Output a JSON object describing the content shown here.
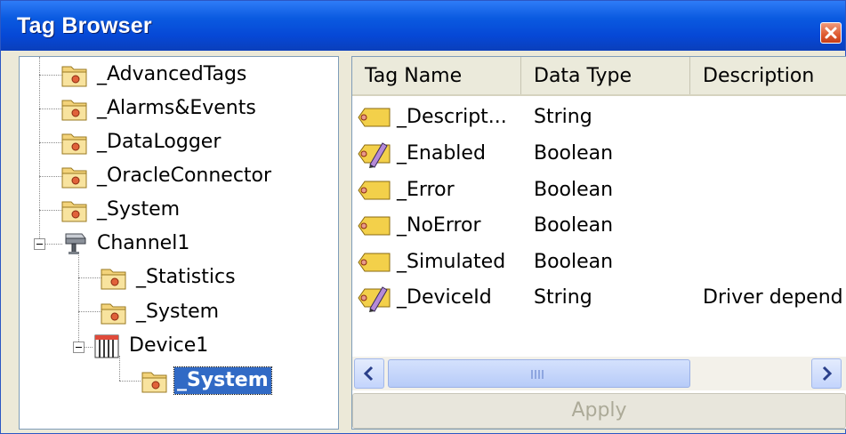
{
  "window": {
    "title": "Tag Browser"
  },
  "tree": {
    "items": [
      {
        "label": "_AdvancedTags",
        "icon": "folder-icon"
      },
      {
        "label": "_Alarms&Events",
        "icon": "folder-icon"
      },
      {
        "label": "_DataLogger",
        "icon": "folder-icon"
      },
      {
        "label": "_OracleConnector",
        "icon": "folder-icon"
      },
      {
        "label": "_System",
        "icon": "folder-icon"
      },
      {
        "label": "Channel1",
        "icon": "channel-icon"
      },
      {
        "label": "_Statistics",
        "icon": "folder-icon"
      },
      {
        "label": "_System",
        "icon": "folder-icon"
      },
      {
        "label": "Device1",
        "icon": "device-icon"
      },
      {
        "label": "_System",
        "icon": "folder-icon",
        "selected": true
      }
    ]
  },
  "table": {
    "columns": [
      "Tag Name",
      "Data Type",
      "Description"
    ],
    "rows": [
      {
        "name": "_Descript...",
        "type": "String",
        "description": "",
        "icon": "tag-readonly-icon"
      },
      {
        "name": "_Enabled",
        "type": "Boolean",
        "description": "",
        "icon": "tag-writable-icon"
      },
      {
        "name": "_Error",
        "type": "Boolean",
        "description": "",
        "icon": "tag-readonly-icon"
      },
      {
        "name": "_NoError",
        "type": "Boolean",
        "description": "",
        "icon": "tag-readonly-icon"
      },
      {
        "name": "_Simulated",
        "type": "Boolean",
        "description": "",
        "icon": "tag-readonly-icon"
      },
      {
        "name": "_DeviceId",
        "type": "String",
        "description": "Driver depend",
        "icon": "tag-writable-icon"
      }
    ]
  },
  "buttons": {
    "apply": "Apply"
  },
  "colors": {
    "title_bar": "#0a5ae0",
    "selection": "#316ac5",
    "close": "#de5a31"
  }
}
